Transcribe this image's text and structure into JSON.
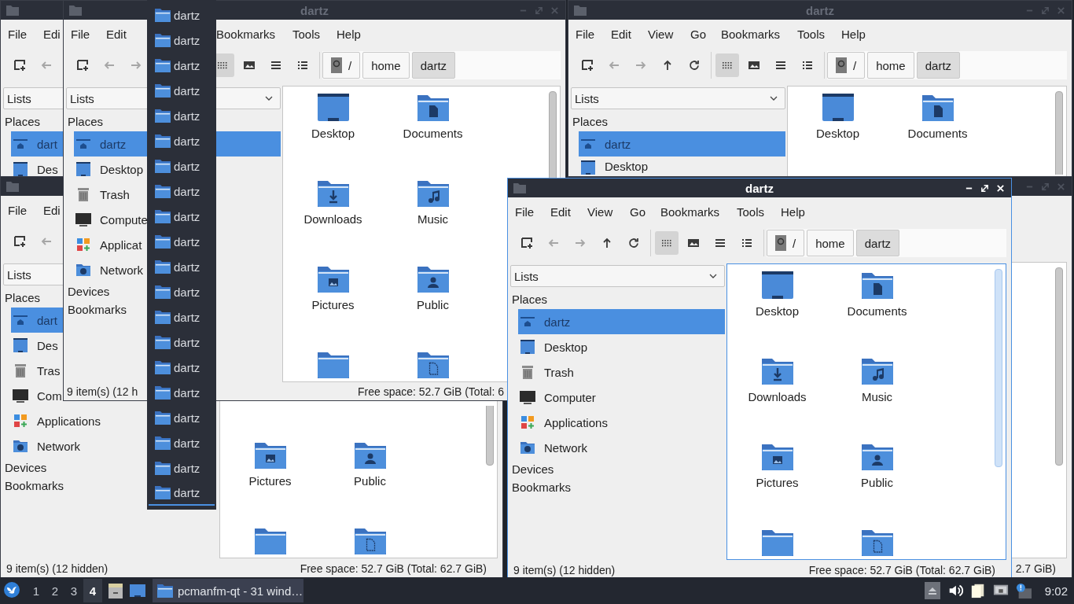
{
  "windows": [
    {
      "active": false,
      "title_icon": true,
      "menu": [
        "File",
        "Edi"
      ],
      "toolbar": [
        {
          "kind": "new-tab",
          "disabled": false
        },
        {
          "kind": "back",
          "disabled": true
        }
      ],
      "sidebar": {
        "dropdown": "Lists",
        "heading": "Places",
        "places": [
          {
            "label": "dart",
            "kind": "home",
            "selected": true
          },
          {
            "label": "Des",
            "kind": "desktop",
            "selected": false
          }
        ]
      }
    },
    {
      "title": "dartz",
      "active": false,
      "title_icon": true,
      "window_buttons": true,
      "menu": [
        "File",
        "Edit",
        "Bookmarks",
        "Tools",
        "Help"
      ],
      "toolbar": [
        {
          "kind": "new-tab",
          "disabled": false
        },
        {
          "kind": "back",
          "disabled": true
        },
        {
          "kind": "forward",
          "disabled": true
        },
        {
          "kind": "icon-view",
          "selected": true
        },
        {
          "kind": "thumbnail",
          "selected": false
        },
        {
          "kind": "compact",
          "selected": false
        },
        {
          "kind": "detailed",
          "selected": false
        }
      ],
      "path": [
        {
          "label": "/",
          "kind": "root",
          "selected": false
        },
        {
          "label": "home",
          "kind": "dir",
          "selected": false
        },
        {
          "label": "dartz",
          "kind": "dir",
          "selected": true
        }
      ],
      "sidebar": {
        "dropdown": "Lists",
        "heading": "Places",
        "places": [
          {
            "label": "dartz",
            "kind": "home",
            "selected": true
          },
          {
            "label": "Desktop",
            "kind": "desktop",
            "selected": false
          },
          {
            "label": "Trash",
            "kind": "trash",
            "selected": false
          },
          {
            "label": "Compute",
            "kind": "computer",
            "selected": false
          },
          {
            "label": "Applicat",
            "kind": "applications",
            "selected": false
          },
          {
            "label": "Network",
            "kind": "network",
            "selected": false
          }
        ],
        "sections": [
          "Devices",
          "Bookmarks"
        ]
      },
      "files": [
        {
          "label": "Desktop",
          "kind": "desktop"
        },
        {
          "label": "Documents",
          "kind": "documents"
        },
        {
          "label": "Downloads",
          "kind": "downloads"
        },
        {
          "label": "Music",
          "kind": "music"
        },
        {
          "label": "Pictures",
          "kind": "pictures"
        },
        {
          "label": "Public",
          "kind": "public"
        },
        {
          "kind": "folder"
        },
        {
          "kind": "templates"
        }
      ],
      "scrollbar": true,
      "status": {
        "left": "9 item(s) (12 h",
        "right": "Free space: 52.7 GiB (Total: 6"
      }
    },
    {
      "title": "dartz",
      "active": false,
      "title_icon": true,
      "window_buttons": true,
      "menu": [
        "File",
        "Edit",
        "View",
        "Go",
        "Bookmarks",
        "Tools",
        "Help"
      ],
      "toolbar": [
        {
          "kind": "new-tab",
          "disabled": false
        },
        {
          "kind": "back",
          "disabled": true
        },
        {
          "kind": "forward",
          "disabled": true
        },
        {
          "kind": "up",
          "disabled": false
        },
        {
          "kind": "reload",
          "disabled": false
        },
        {
          "kind": "icon-view",
          "selected": true
        },
        {
          "kind": "thumbnail",
          "selected": false
        },
        {
          "kind": "compact",
          "selected": false
        },
        {
          "kind": "detailed",
          "selected": false
        }
      ],
      "path": [
        {
          "label": "/",
          "kind": "root",
          "selected": false
        },
        {
          "label": "home",
          "kind": "dir",
          "selected": false
        },
        {
          "label": "dartz",
          "kind": "dir",
          "selected": true
        }
      ],
      "sidebar": {
        "dropdown": "Lists",
        "heading": "Places",
        "places": [
          {
            "label": "dartz",
            "kind": "home",
            "selected": true
          },
          {
            "label": "Desktop",
            "kind": "desktop",
            "selected": false
          }
        ]
      },
      "files": [
        {
          "label": "Desktop",
          "kind": "desktop"
        },
        {
          "label": "Documents",
          "kind": "documents"
        }
      ],
      "scrollbar": true
    },
    {
      "active": false,
      "title_icon": true,
      "menu": [
        "File",
        "Edi"
      ],
      "toolbar": [
        {
          "kind": "new-tab",
          "disabled": false
        },
        {
          "kind": "back",
          "disabled": true
        }
      ],
      "sidebar": {
        "dropdown": "Lists",
        "heading": "Places",
        "places": [
          {
            "label": "dart",
            "kind": "home",
            "selected": true
          },
          {
            "label": "Des",
            "kind": "desktop",
            "selected": false
          },
          {
            "label": "Tras",
            "kind": "trash",
            "selected": false
          },
          {
            "label": "Com",
            "kind": "computer",
            "selected": false
          },
          {
            "label": "Applications",
            "kind": "applications",
            "selected": false
          },
          {
            "label": "Network",
            "kind": "network",
            "selected": false
          }
        ],
        "sections": [
          "Devices",
          "Bookmarks"
        ]
      },
      "files": [
        {
          "label": "Pictures",
          "kind": "pictures"
        },
        {
          "label": "Public",
          "kind": "public"
        },
        {
          "kind": "folder"
        },
        {
          "kind": "templates"
        }
      ],
      "scrollbar": true,
      "status": {
        "left": "9 item(s) (12 hidden)",
        "right": "Free space: 52.7 GiB (Total: 62.7 GiB)"
      }
    },
    {
      "title": "dartz",
      "active": true,
      "title_icon": true,
      "window_buttons": true,
      "menu": [
        "File",
        "Edit",
        "View",
        "Go",
        "Bookmarks",
        "Tools",
        "Help"
      ],
      "toolbar": [
        {
          "kind": "new-tab",
          "disabled": false
        },
        {
          "kind": "back",
          "disabled": true
        },
        {
          "kind": "forward",
          "disabled": true
        },
        {
          "kind": "up",
          "disabled": false
        },
        {
          "kind": "reload",
          "disabled": false
        },
        {
          "kind": "icon-view",
          "selected": true
        },
        {
          "kind": "thumbnail",
          "selected": false
        },
        {
          "kind": "compact",
          "selected": false
        },
        {
          "kind": "detailed",
          "selected": false
        }
      ],
      "path": [
        {
          "label": "/",
          "kind": "root",
          "selected": false
        },
        {
          "label": "home",
          "kind": "dir",
          "selected": false
        },
        {
          "label": "dartz",
          "kind": "dir",
          "selected": true
        }
      ],
      "sidebar": {
        "dropdown": "Lists",
        "heading": "Places",
        "places": [
          {
            "label": "dartz",
            "kind": "home",
            "selected": true
          },
          {
            "label": "Desktop",
            "kind": "desktop",
            "selected": false
          },
          {
            "label": "Trash",
            "kind": "trash",
            "selected": false
          },
          {
            "label": "Computer",
            "kind": "computer",
            "selected": false
          },
          {
            "label": "Applications",
            "kind": "applications",
            "selected": false
          },
          {
            "label": "Network",
            "kind": "network",
            "selected": false
          }
        ],
        "sections": [
          "Devices",
          "Bookmarks"
        ]
      },
      "files": [
        {
          "label": "Desktop",
          "kind": "desktop"
        },
        {
          "label": "Documents",
          "kind": "documents"
        },
        {
          "label": "Downloads",
          "kind": "downloads"
        },
        {
          "label": "Music",
          "kind": "music"
        },
        {
          "label": "Pictures",
          "kind": "pictures"
        },
        {
          "label": "Public",
          "kind": "public"
        },
        {
          "kind": "folder"
        },
        {
          "kind": "templates"
        }
      ],
      "scrollbar": true,
      "status": {
        "left": "9 item(s) (12 hidden)",
        "right": "Free space: 52.7 GiB (Total: 62.7 GiB)"
      }
    },
    {
      "active": false,
      "window_buttons": true,
      "scrollbar": true,
      "status": {
        "right": "2.7 GiB)"
      }
    }
  ],
  "window_menu": {
    "items": [
      {
        "label": "dartz",
        "selected": false
      },
      {
        "label": "dartz",
        "selected": false
      },
      {
        "label": "dartz",
        "selected": false
      },
      {
        "label": "dartz",
        "selected": false
      },
      {
        "label": "dartz",
        "selected": false
      },
      {
        "label": "dartz",
        "selected": false
      },
      {
        "label": "dartz",
        "selected": false
      },
      {
        "label": "dartz",
        "selected": false
      },
      {
        "label": "dartz",
        "selected": false
      },
      {
        "label": "dartz",
        "selected": false
      },
      {
        "label": "dartz",
        "selected": false
      },
      {
        "label": "dartz",
        "selected": false
      },
      {
        "label": "dartz",
        "selected": false
      },
      {
        "label": "dartz",
        "selected": false
      },
      {
        "label": "dartz",
        "selected": false
      },
      {
        "label": "dartz",
        "selected": false
      },
      {
        "label": "dartz",
        "selected": false
      },
      {
        "label": "dartz",
        "selected": false
      },
      {
        "label": "dartz",
        "selected": false
      },
      {
        "label": "dartz",
        "selected": true
      }
    ]
  },
  "taskbar": {
    "workspaces": [
      {
        "label": "1",
        "selected": false
      },
      {
        "label": "2",
        "selected": false
      },
      {
        "label": "3",
        "selected": false
      },
      {
        "label": "4",
        "selected": true
      }
    ],
    "task": "pcmanfm-qt - 31 wind…",
    "clock": "9:02"
  }
}
